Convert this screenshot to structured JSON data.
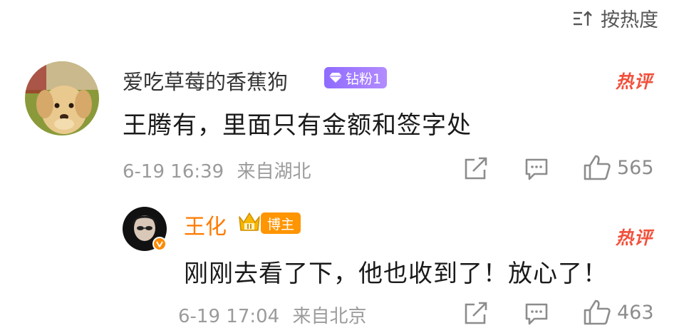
{
  "sort": {
    "label": "按热度",
    "icon": "sort-icon"
  },
  "comments": [
    {
      "user": "爱吃草莓的香蕉狗",
      "badge": "钻粉1",
      "tag": "热评",
      "text": "王腾有，里面只有金额和签字处",
      "time": "6-19 16:39",
      "location": "来自湖北",
      "likes": "565"
    },
    {
      "user": "王化",
      "badge": "博主",
      "tag": "热评",
      "text": "刚刚去看了下，他也收到了！放心了！",
      "time": "6-19 17:04",
      "location": "来自北京",
      "likes": "463"
    }
  ],
  "colors": {
    "hot": "#f2503b",
    "blogger_name": "#ff7a00",
    "fan_badge": "#9a75ff",
    "meta": "#9b9b9b"
  }
}
